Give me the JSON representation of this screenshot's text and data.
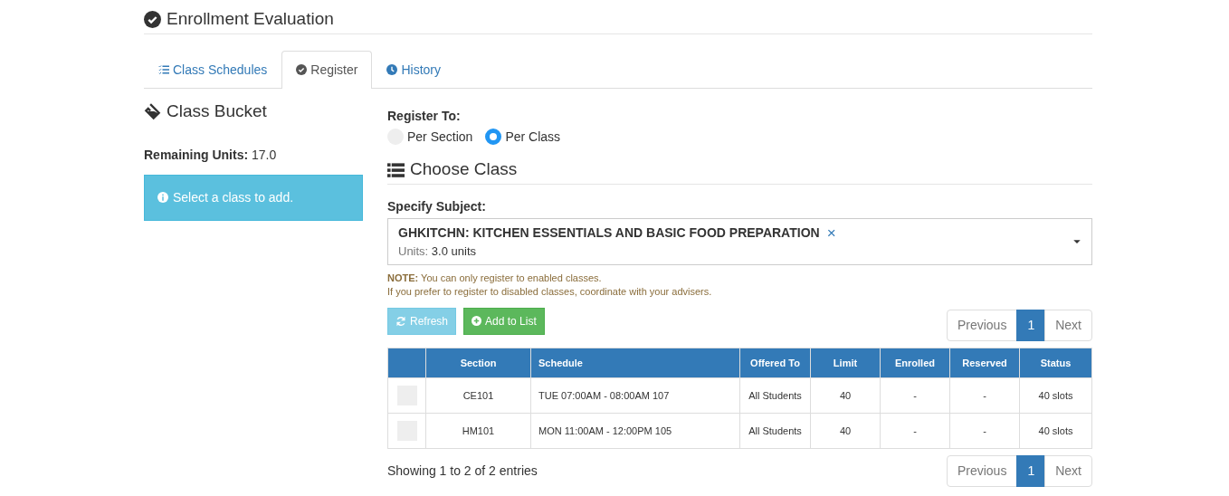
{
  "page_title": "Enrollment Evaluation",
  "tabs": [
    {
      "label": "Class Schedules",
      "kind": "schedules",
      "selected": false
    },
    {
      "label": "Register",
      "kind": "register",
      "selected": true
    },
    {
      "label": "History",
      "kind": "history",
      "selected": false
    }
  ],
  "bucket": {
    "title": "Class Bucket",
    "remaining_label": "Remaining Units:",
    "remaining_value": "17.0",
    "info": "Select a class to add."
  },
  "register_to": {
    "label": "Register To:",
    "options": [
      {
        "label": "Per Section",
        "selected": false
      },
      {
        "label": "Per Class",
        "selected": true
      }
    ]
  },
  "choose_title": "Choose Class",
  "subject": {
    "label": "Specify Subject:",
    "value": "GHKITCHN: KITCHEN ESSENTIALS AND BASIC FOOD PREPARATION",
    "units_label": "Units:",
    "units_value": "3.0 units",
    "clear": "×"
  },
  "note": {
    "label": "NOTE:",
    "line1": "You can only register to enabled classes.",
    "line2": "If you prefer to register to disabled classes, coordinate with your advisers."
  },
  "buttons": [
    {
      "label": "Refresh",
      "kind": "refresh",
      "disabled": true
    },
    {
      "label": "Add to List",
      "kind": "add",
      "disabled": false
    }
  ],
  "pagination": [
    {
      "label": "Previous",
      "selected": false
    },
    {
      "label": "1",
      "selected": true
    },
    {
      "label": "Next",
      "selected": false
    }
  ],
  "table": {
    "columns": [
      "Section",
      "Schedule",
      "Offered To",
      "Limit",
      "Enrolled",
      "Reserved",
      "Status"
    ],
    "rows": [
      {
        "checked": false,
        "cells": [
          "CE101",
          "TUE 07:00AM - 08:00AM 107",
          "All Students",
          "40",
          "-",
          "-",
          "40 slots"
        ]
      },
      {
        "checked": false,
        "cells": [
          "HM101",
          "MON 11:00AM - 12:00PM 105",
          "All Students",
          "40",
          "-",
          "-",
          "40 slots"
        ]
      }
    ]
  },
  "footer_info": "Showing 1 to 2 of 2 entries",
  "bottom_pagination": [
    {
      "label": "Previous",
      "selected": false
    },
    {
      "label": "1",
      "selected": true
    },
    {
      "label": "Next",
      "selected": false
    }
  ]
}
